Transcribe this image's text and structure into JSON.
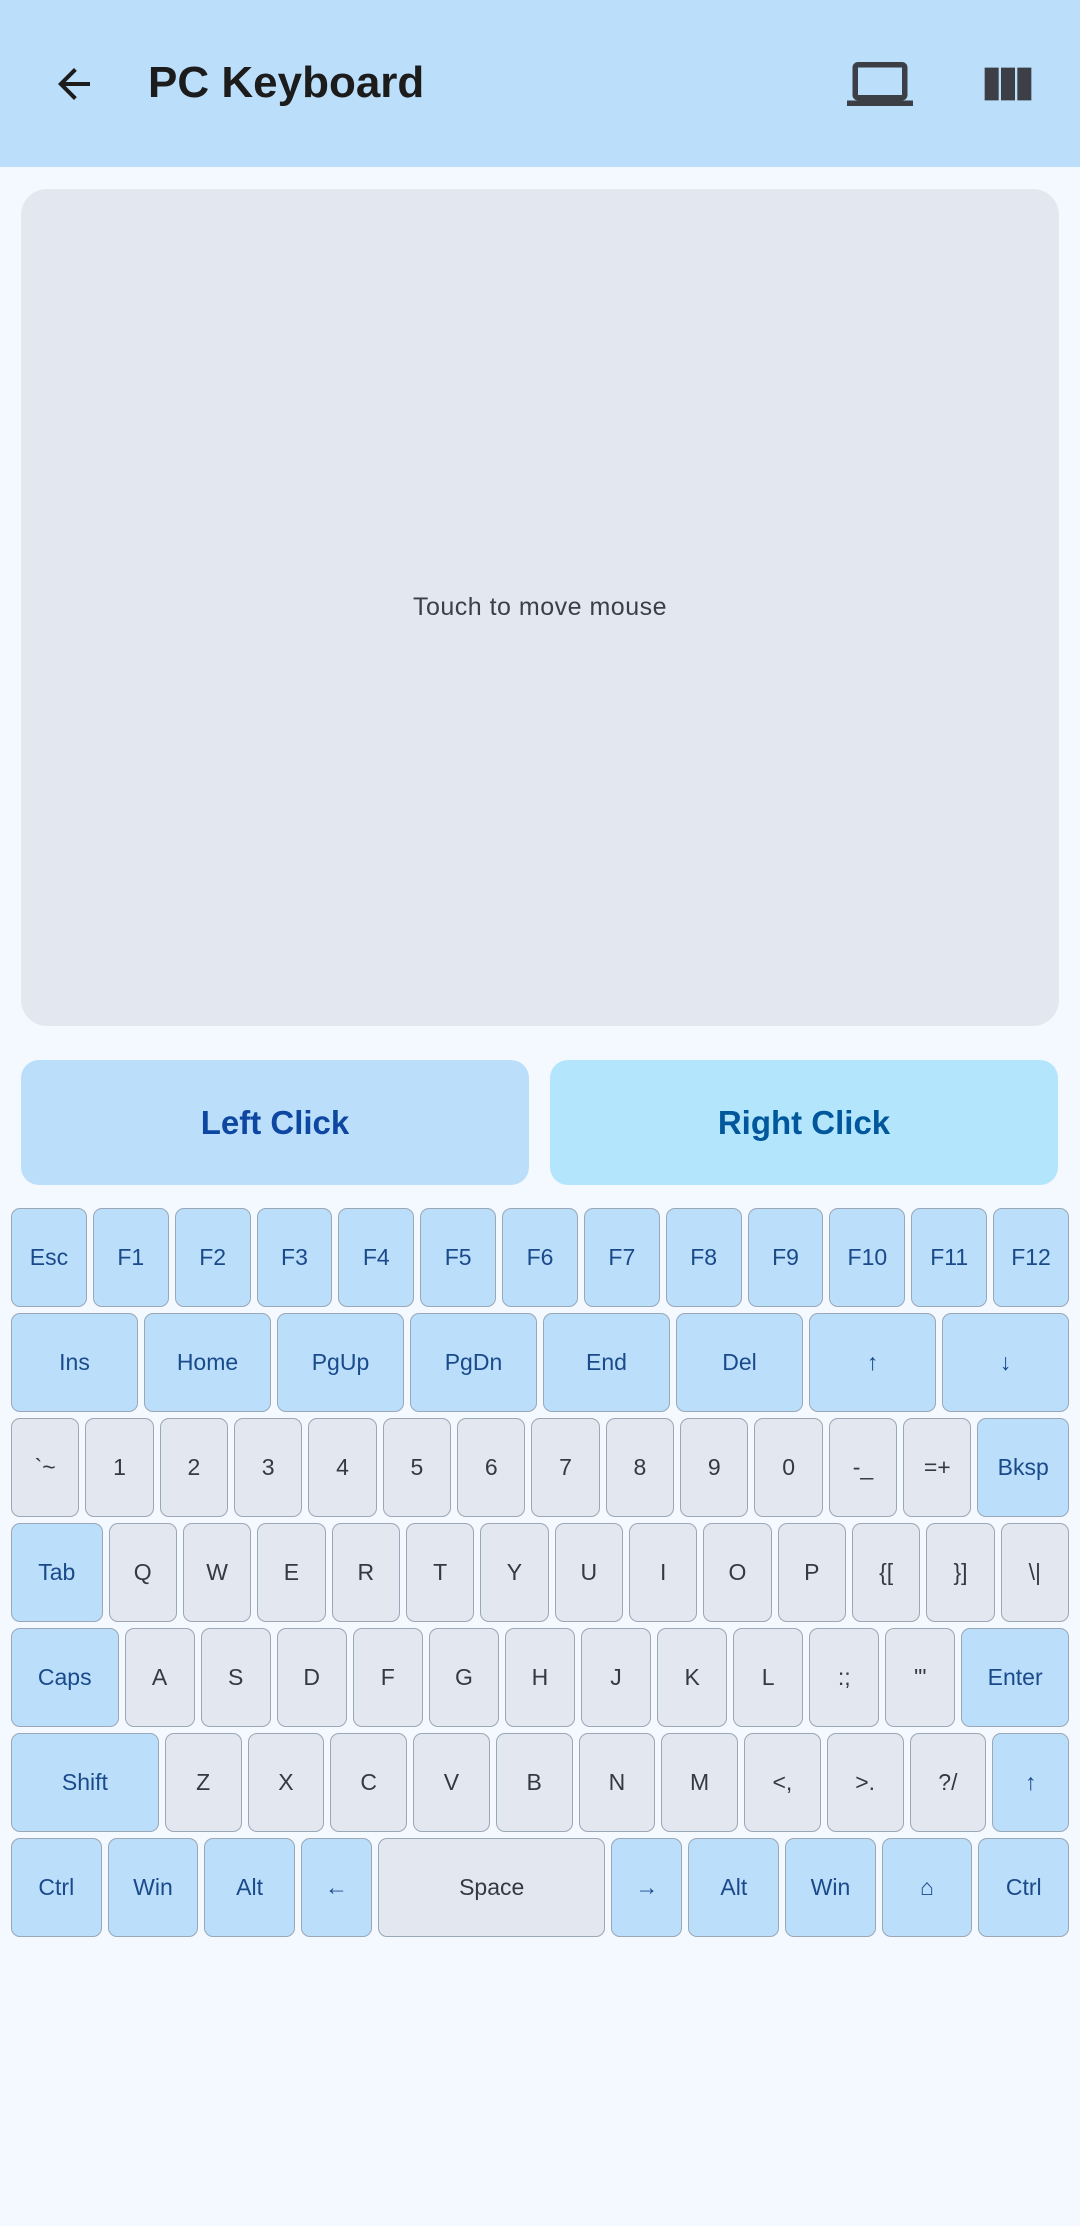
{
  "appbar": {
    "title": "PC Keyboard",
    "back_icon": "arrow-left-icon",
    "laptop_icon": "laptop-icon",
    "columns_icon": "view-columns-icon"
  },
  "touchpad": {
    "hint": "Touch to move mouse"
  },
  "clicks": {
    "left": "Left Click",
    "right": "Right Click"
  },
  "keyboard": {
    "rows": [
      [
        {
          "label": "Esc",
          "special": true
        },
        {
          "label": "F1",
          "special": true
        },
        {
          "label": "F2",
          "special": true
        },
        {
          "label": "F3",
          "special": true
        },
        {
          "label": "F4",
          "special": true
        },
        {
          "label": "F5",
          "special": true
        },
        {
          "label": "F6",
          "special": true
        },
        {
          "label": "F7",
          "special": true
        },
        {
          "label": "F8",
          "special": true
        },
        {
          "label": "F9",
          "special": true
        },
        {
          "label": "F10",
          "special": true
        },
        {
          "label": "F11",
          "special": true
        },
        {
          "label": "F12",
          "special": true
        }
      ],
      [
        {
          "label": "Ins",
          "special": true
        },
        {
          "label": "Home",
          "special": true
        },
        {
          "label": "PgUp",
          "special": true
        },
        {
          "label": "PgDn",
          "special": true
        },
        {
          "label": "End",
          "special": true
        },
        {
          "label": "Del",
          "special": true
        },
        {
          "label": "↑",
          "special": true
        },
        {
          "label": "↓",
          "special": true
        }
      ],
      [
        {
          "label": "`~",
          "special": false
        },
        {
          "label": "1",
          "special": false
        },
        {
          "label": "2",
          "special": false
        },
        {
          "label": "3",
          "special": false
        },
        {
          "label": "4",
          "special": false
        },
        {
          "label": "5",
          "special": false
        },
        {
          "label": "6",
          "special": false
        },
        {
          "label": "7",
          "special": false
        },
        {
          "label": "8",
          "special": false
        },
        {
          "label": "9",
          "special": false
        },
        {
          "label": "0",
          "special": false
        },
        {
          "label": "-_",
          "special": false
        },
        {
          "label": "=+",
          "special": false
        },
        {
          "label": "Bksp",
          "special": true
        }
      ],
      [
        {
          "label": "Tab",
          "special": true
        },
        {
          "label": "Q",
          "special": false
        },
        {
          "label": "W",
          "special": false
        },
        {
          "label": "E",
          "special": false
        },
        {
          "label": "R",
          "special": false
        },
        {
          "label": "T",
          "special": false
        },
        {
          "label": "Y",
          "special": false
        },
        {
          "label": "U",
          "special": false
        },
        {
          "label": "I",
          "special": false
        },
        {
          "label": "O",
          "special": false
        },
        {
          "label": "P",
          "special": false
        },
        {
          "label": "{[",
          "special": false
        },
        {
          "label": "}]",
          "special": false
        },
        {
          "label": "\\|",
          "special": false
        }
      ],
      [
        {
          "label": "Caps",
          "special": true
        },
        {
          "label": "A",
          "special": false
        },
        {
          "label": "S",
          "special": false
        },
        {
          "label": "D",
          "special": false
        },
        {
          "label": "F",
          "special": false
        },
        {
          "label": "G",
          "special": false
        },
        {
          "label": "H",
          "special": false
        },
        {
          "label": "J",
          "special": false
        },
        {
          "label": "K",
          "special": false
        },
        {
          "label": "L",
          "special": false
        },
        {
          "label": ":;",
          "special": false
        },
        {
          "label": "\"'",
          "special": false
        },
        {
          "label": "Enter",
          "special": true
        }
      ],
      [
        {
          "label": "Shift",
          "special": true
        },
        {
          "label": "Z",
          "special": false
        },
        {
          "label": "X",
          "special": false
        },
        {
          "label": "C",
          "special": false
        },
        {
          "label": "V",
          "special": false
        },
        {
          "label": "B",
          "special": false
        },
        {
          "label": "N",
          "special": false
        },
        {
          "label": "M",
          "special": false
        },
        {
          "label": "<,",
          "special": false
        },
        {
          "label": ">.",
          "special": false
        },
        {
          "label": "?/",
          "special": false
        },
        {
          "label": "↑",
          "special": true
        }
      ],
      [
        {
          "label": "Ctrl",
          "special": true
        },
        {
          "label": "Win",
          "special": true
        },
        {
          "label": "Alt",
          "special": true
        },
        {
          "label": "←",
          "special": true
        },
        {
          "label": "Space",
          "special": false
        },
        {
          "label": "→",
          "special": true
        },
        {
          "label": "Alt",
          "special": true
        },
        {
          "label": "Win",
          "special": true
        },
        {
          "label": "⌂",
          "special": true
        },
        {
          "label": "Ctrl",
          "special": true
        }
      ]
    ]
  },
  "colors": {
    "appbar": "#bbdefb",
    "special_key": "#bbdefb",
    "normal_key": "#e2e7f0",
    "accent_text": "#0d47a1"
  }
}
